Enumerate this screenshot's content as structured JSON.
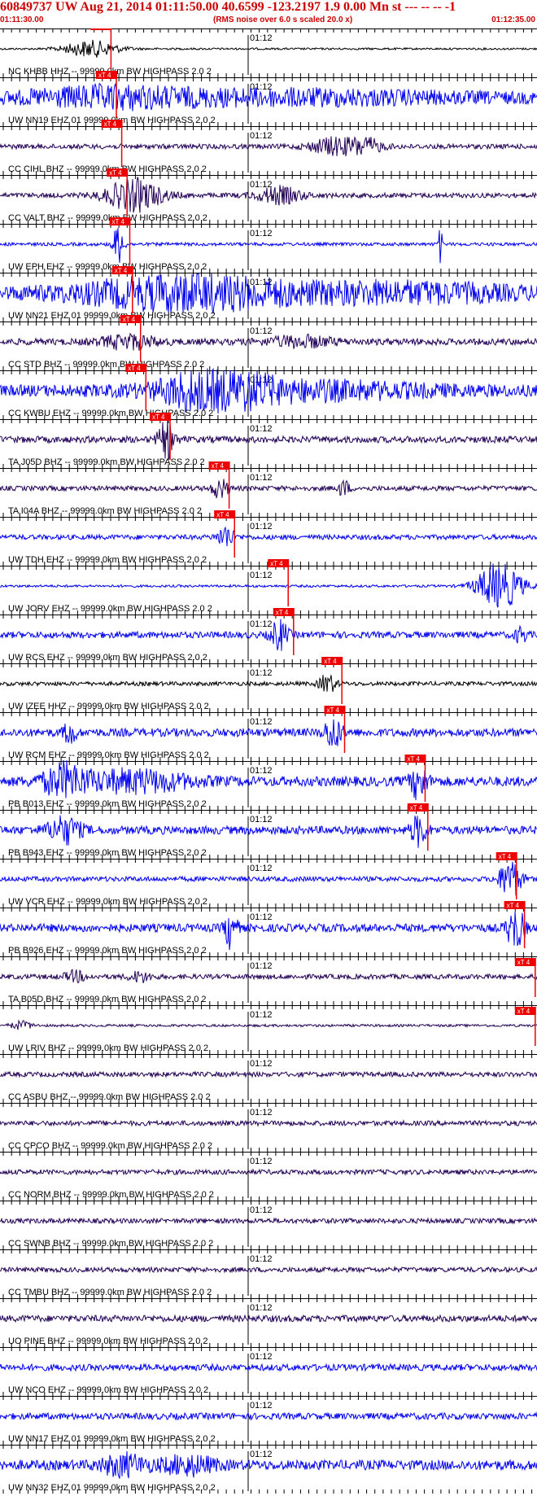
{
  "header": {
    "title": "60849737 UW Aug 21, 2014 01:11:50.00   40.6599 -123.2197  1.9 0.00 Mn st --- -- --  -1",
    "start_time": "01:11:30.00",
    "note": "(RMS noise over 6.0 s scaled 20.0 x)",
    "end_time": "01:12:35.00"
  },
  "time_mark": "01:12",
  "pick_label": "xT 4",
  "colors": {
    "header": "#cc0000",
    "pick": "#ee0000",
    "black": "#000000",
    "blue": "#0000ee",
    "navy": "#220055"
  },
  "traces": [
    {
      "label": "NC KHBB HHZ -- 99999.0km BW  HIGHPASS  2.0  2",
      "color": "black",
      "pick": 0.19,
      "bursts": [
        [
          0.17,
          0.05,
          10
        ]
      ],
      "noise": 1.2
    },
    {
      "label": "UW NN19 EHZ 01 99999.0km BW  HIGHPASS  2.0  2",
      "color": "blue",
      "pick": 0.2,
      "bursts": [
        [
          0.2,
          0.15,
          9
        ],
        [
          0.55,
          0.3,
          6
        ]
      ],
      "noise": 7
    },
    {
      "label": "CC CIHL BHZ -- 99999.0km BW  HIGHPASS  2.0  2",
      "color": "navy",
      "pick": 0.21,
      "bursts": [
        [
          0.62,
          0.04,
          10
        ],
        [
          0.68,
          0.03,
          10
        ]
      ],
      "noise": 3
    },
    {
      "label": "CC VALT BHZ -- 99999.0km BW  HIGHPASS  2.0  2",
      "color": "navy",
      "pick": 0.22,
      "bursts": [
        [
          0.25,
          0.05,
          20
        ],
        [
          0.52,
          0.04,
          10
        ]
      ],
      "noise": 3
    },
    {
      "label": "UW EPH EHZ -- 99999.0km BW  HIGHPASS  2.0  2",
      "color": "blue",
      "pick": 0.225,
      "bursts": [
        [
          0.22,
          0.01,
          24
        ],
        [
          0.82,
          0.003,
          25
        ]
      ],
      "noise": 2
    },
    {
      "label": "UW NN21 EHZ 01 99999.0km BW  HIGHPASS  2.0  2",
      "color": "blue",
      "pick": 0.23,
      "bursts": [
        [
          0.35,
          0.2,
          18
        ],
        [
          0.75,
          0.2,
          9
        ]
      ],
      "noise": 8
    },
    {
      "label": "CC STD BHZ -- 99999.0km BW  HIGHPASS  2.0  2",
      "color": "navy",
      "pick": 0.245,
      "bursts": [
        [
          0.24,
          0.05,
          8
        ],
        [
          0.56,
          0.06,
          6
        ]
      ],
      "noise": 4
    },
    {
      "label": "CC KWBU EHZ -- 99999.0km BW  HIGHPASS  2.0  2",
      "color": "blue",
      "pick": 0.255,
      "bursts": [
        [
          0.4,
          0.08,
          28
        ],
        [
          0.55,
          0.25,
          9
        ]
      ],
      "noise": 7
    },
    {
      "label": "TA J05D BHZ -- 99999.0km BW  HIGHPASS  2.0  2",
      "color": "navy",
      "pick": 0.3,
      "bursts": [
        [
          0.31,
          0.015,
          22
        ]
      ],
      "noise": 4
    },
    {
      "label": "TA I04A BHZ -- 99999.0km BW  HIGHPASS  2.0  2",
      "color": "navy",
      "pick": 0.41,
      "bursts": [
        [
          0.41,
          0.015,
          12
        ],
        [
          0.64,
          0.01,
          10
        ]
      ],
      "noise": 3
    },
    {
      "label": "UW TDH EHZ -- 99999.0km BW  HIGHPASS  2.0  2",
      "color": "blue",
      "pick": 0.42,
      "bursts": [
        [
          0.42,
          0.015,
          14
        ]
      ],
      "noise": 3
    },
    {
      "label": "UW JORV EHZ -- 99999.0km BW  HIGHPASS  2.0  2",
      "color": "blue",
      "pick": 0.52,
      "bursts": [
        [
          0.93,
          0.04,
          30
        ]
      ],
      "noise": 1.5
    },
    {
      "label": "UW RCS EHZ -- 99999.0km BW  HIGHPASS  2.0  2",
      "color": "blue",
      "pick": 0.53,
      "bursts": [
        [
          0.52,
          0.015,
          18
        ],
        [
          0.97,
          0.01,
          10
        ]
      ],
      "noise": 4
    },
    {
      "label": "UW IZEE HHZ -- 99999.0km BW  HIGHPASS  2.0  2",
      "color": "black",
      "pick": 0.62,
      "bursts": [
        [
          0.61,
          0.015,
          12
        ]
      ],
      "noise": 2.5
    },
    {
      "label": "UW RCM EHZ -- 99999.0km BW  HIGHPASS  2.0  2",
      "color": "blue",
      "pick": 0.625,
      "bursts": [
        [
          0.13,
          0.01,
          16
        ],
        [
          0.62,
          0.015,
          20
        ]
      ],
      "noise": 5
    },
    {
      "label": "PB B013 EHZ -- 99999.0km BW  HIGHPASS  2.0  2",
      "color": "blue",
      "pick": 0.775,
      "bursts": [
        [
          0.12,
          0.04,
          18
        ],
        [
          0.25,
          0.1,
          12
        ],
        [
          0.78,
          0.015,
          20
        ]
      ],
      "noise": 6
    },
    {
      "label": "PB B943 EHZ -- 99999.0km BW  HIGHPASS  2.0  2",
      "color": "blue",
      "pick": 0.78,
      "bursts": [
        [
          0.12,
          0.03,
          16
        ],
        [
          0.78,
          0.015,
          18
        ]
      ],
      "noise": 5
    },
    {
      "label": "UW VCR EHZ -- 99999.0km BW  HIGHPASS  2.0  2",
      "color": "blue",
      "pick": 0.945,
      "bursts": [
        [
          0.95,
          0.02,
          24
        ]
      ],
      "noise": 3
    },
    {
      "label": "PB B926 EHZ -- 99999.0km BW  HIGHPASS  2.0  2",
      "color": "blue",
      "pick": 0.96,
      "bursts": [
        [
          0.43,
          0.01,
          30
        ],
        [
          0.96,
          0.015,
          28
        ]
      ],
      "noise": 5
    },
    {
      "label": "TA B05D BHZ -- 99999.0km BW  HIGHPASS  2.0  2",
      "color": "navy",
      "pick": 0.98,
      "pick_top": true,
      "bursts": [
        [
          0.14,
          0.02,
          6
        ],
        [
          0.26,
          0.02,
          6
        ]
      ],
      "noise": 3
    },
    {
      "label": "UW LRIV BHZ -- 99999.0km BW  HIGHPASS  2.0  2",
      "color": "navy",
      "pick": 0.98,
      "pick_top": true,
      "bursts": [
        [
          0.04,
          0.02,
          5
        ]
      ],
      "noise": 1.5
    },
    {
      "label": "CC ASBU BHZ -- 99999.0km BW  HIGHPASS  2.0  2",
      "color": "navy",
      "bursts": [],
      "noise": 3
    },
    {
      "label": "CC CPCO BHZ -- 99999.0km BW  HIGHPASS  2.0  2",
      "color": "navy",
      "bursts": [],
      "noise": 3
    },
    {
      "label": "CC NORM BHZ -- 99999.0km BW  HIGHPASS  2.0  2",
      "color": "navy",
      "bursts": [],
      "noise": 3
    },
    {
      "label": "CC SWNB BHZ -- 99999.0km BW  HIGHPASS  2.0  2",
      "color": "navy",
      "bursts": [],
      "noise": 3
    },
    {
      "label": "CC TMBU BHZ -- 99999.0km BW  HIGHPASS  2.0  2",
      "color": "navy",
      "bursts": [],
      "noise": 3
    },
    {
      "label": "UO PINE BHZ -- 99999.0km BW  HIGHPASS  2.0  2",
      "color": "navy",
      "bursts": [],
      "noise": 4
    },
    {
      "label": "UW NCO EHZ -- 99999.0km BW  HIGHPASS  2.0  2",
      "color": "blue",
      "bursts": [],
      "noise": 4
    },
    {
      "label": "UW NN17 EHZ 01 99999.0km BW  HIGHPASS  2.0  2",
      "color": "blue",
      "bursts": [],
      "noise": 4
    },
    {
      "label": "UW NN32 EHZ 01 99999.0km BW  HIGHPASS  2.0  2",
      "color": "blue",
      "bursts": [
        [
          0.23,
          0.04,
          12
        ],
        [
          0.35,
          0.05,
          10
        ]
      ],
      "noise": 6
    }
  ]
}
